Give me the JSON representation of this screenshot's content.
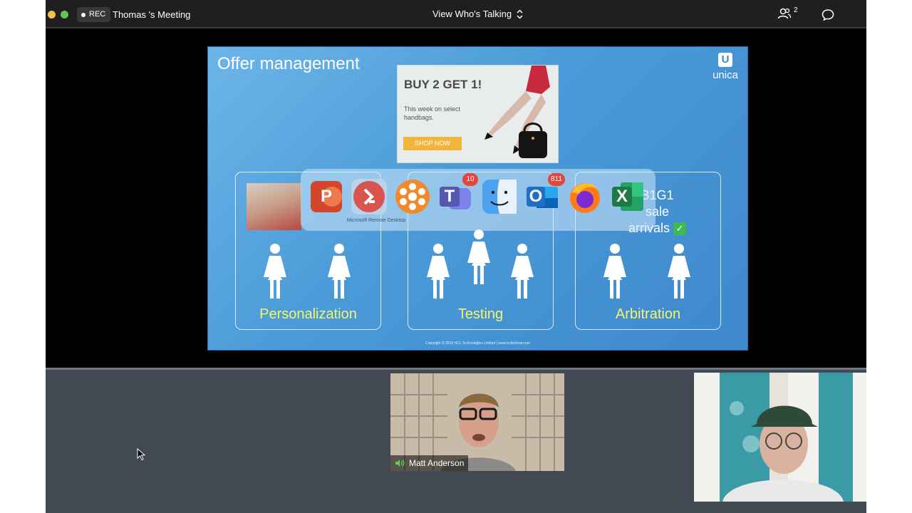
{
  "meeting": {
    "rec_label": "REC",
    "title": "Thomas 's Meeting",
    "view_label": "View Who's Talking",
    "participant_count": "2"
  },
  "slide": {
    "title": "Offer management",
    "brand": "unica",
    "brand_glyph": "U",
    "ad": {
      "headline": "BUY 2 GET 1!",
      "subtext": "This week on select handbags.",
      "button": "SHOP NOW"
    },
    "boxes": [
      {
        "label": "Personalization"
      },
      {
        "label": "Testing"
      },
      {
        "label": "Arbitration"
      }
    ],
    "side_text_line1": "B1G1",
    "side_text_line2": "sale",
    "side_text_line3": "arrivals",
    "check_glyph": "✓",
    "footer": "Copyright © 2019 HCL Technologies Limited  |  www.hcltechsw.com"
  },
  "dock": {
    "apps": [
      {
        "name": "PowerPoint",
        "glyph": "P",
        "color": "#d2472b",
        "badge": ""
      },
      {
        "name": "Microsoft Remote Desktop",
        "glyph": "",
        "color": "#d9534f",
        "badge": ""
      },
      {
        "name": "Asterisk app",
        "glyph": "✱",
        "color": "#f08a2c",
        "badge": ""
      },
      {
        "name": "Microsoft Teams",
        "glyph": "T",
        "color": "#5558af",
        "badge": "10"
      },
      {
        "name": "Finder",
        "glyph": "",
        "color": "#4aa2f0",
        "badge": ""
      },
      {
        "name": "Microsoft Outlook",
        "glyph": "O",
        "color": "#1f6fc6",
        "badge": "811"
      },
      {
        "name": "Firefox",
        "glyph": "",
        "color": "#ff7b1c",
        "badge": ""
      },
      {
        "name": "Microsoft Excel",
        "glyph": "X",
        "color": "#1e7a44",
        "badge": ""
      }
    ],
    "tooltip": "Microsoft Remote Desktop"
  },
  "participants": {
    "speaker_name": "Matt Anderson"
  },
  "colors": {
    "accent_green": "#61c454",
    "slide_blue": "#4a9ad8",
    "label_yellow": "#f4f472"
  }
}
